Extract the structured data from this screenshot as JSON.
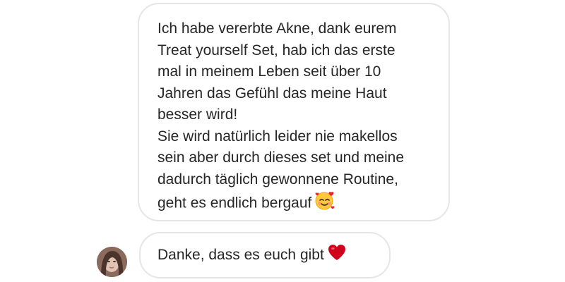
{
  "messages": [
    {
      "text": "Ich habe vererbte Akne, dank eurem\nTreat yourself Set, hab ich das erste\nmal in meinem Leben seit über 10\nJahren das Gefühl das meine Haut\nbesser wird!\nSie wird natürlich leider nie makellos\nsein aber durch dieses set und meine\ndadurch täglich gewonnene Routine,\ngeht es endlich bergauf",
      "emoji": "smiling-face-with-hearts-icon"
    },
    {
      "text": "Danke, dass es euch gibt",
      "emoji": "red-heart-icon"
    }
  ],
  "colors": {
    "bubble_border": "#e6e6e6",
    "text": "#262626",
    "heart": "#d0021b",
    "emoji_face": "#ffca3a"
  }
}
